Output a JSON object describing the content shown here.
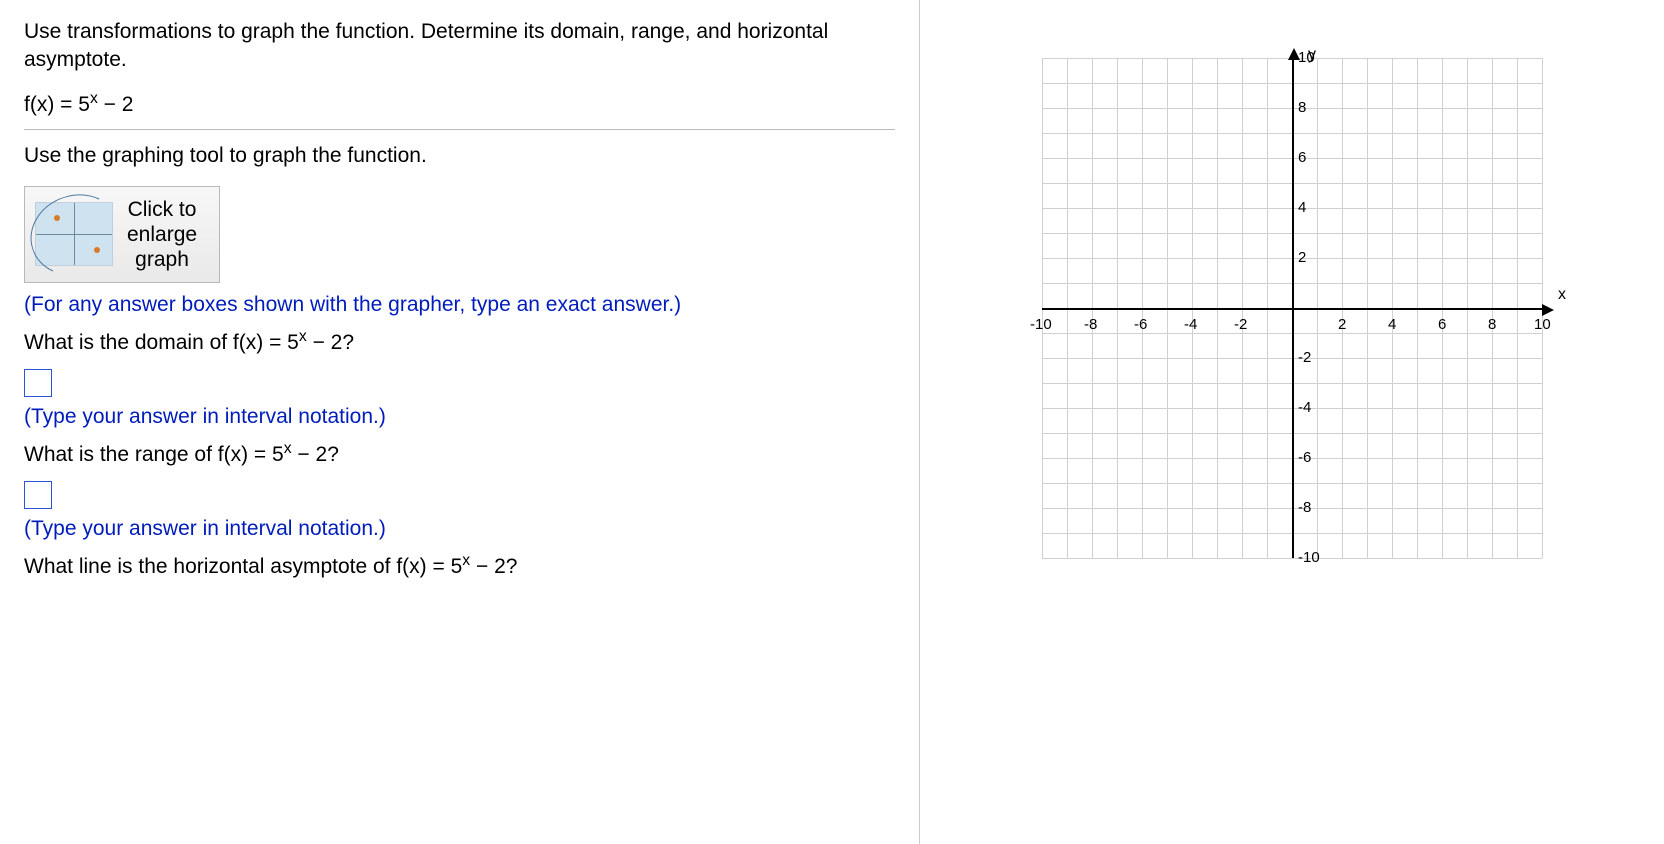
{
  "question": {
    "instr": "Use transformations to graph the function. Determine its domain, range, and horizontal asymptote.",
    "func_pre": "f(x) = 5",
    "func_sup": "x",
    "func_post": " − 2",
    "tool_instr": "Use the graphing tool to graph the function.",
    "grapher_line1": "Click to",
    "grapher_line2": "enlarge",
    "grapher_line3": "graph",
    "grapher_note": "(For any answer boxes shown with the grapher, type an exact answer.)",
    "q_domain_pre": "What is the domain of f(x) = 5",
    "q_domain_sup": "x",
    "q_domain_post": " − 2?",
    "hint_interval": "(Type your answer in interval notation.)",
    "q_range_pre": "What is the range of f(x) = 5",
    "q_range_sup": "x",
    "q_range_post": " − 2?",
    "q_asym_pre": "What line is the horizontal asymptote of f(x) = 5",
    "q_asym_sup": "x",
    "q_asym_post": " − 2?"
  },
  "chart_data": {
    "type": "scatter",
    "title": "",
    "x": [],
    "y": [],
    "xlabel": "x",
    "ylabel": "y",
    "xlim": [
      -10,
      10
    ],
    "ylim": [
      -10,
      10
    ],
    "xticks": [
      -10,
      -8,
      -6,
      -4,
      -2,
      2,
      4,
      6,
      8,
      10
    ],
    "yticks": [
      -10,
      -8,
      -6,
      -4,
      -2,
      2,
      4,
      6,
      8,
      10
    ],
    "grid": true
  }
}
